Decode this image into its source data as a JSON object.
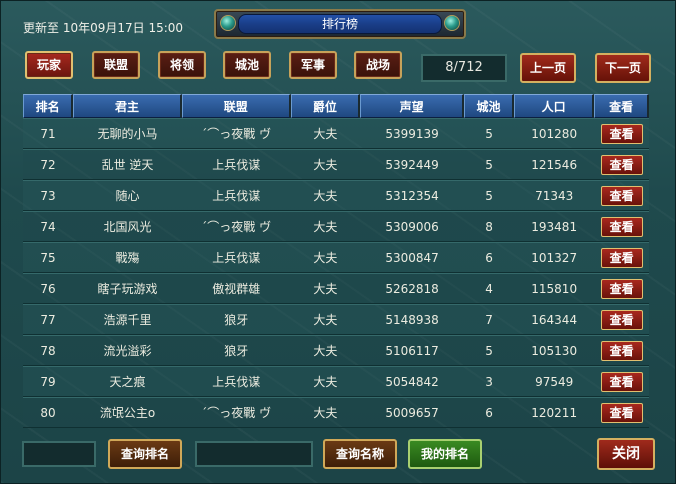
{
  "header": {
    "update_text": "更新至 10年09月17日 15:00",
    "title": "排行榜"
  },
  "tabs": [
    {
      "label": "玩家",
      "active": true
    },
    {
      "label": "联盟"
    },
    {
      "label": "将领"
    },
    {
      "label": "城池"
    },
    {
      "label": "军事"
    },
    {
      "label": "战场"
    }
  ],
  "pagination": {
    "page_text": "8/712",
    "prev_label": "上一页",
    "next_label": "下一页"
  },
  "table": {
    "columns": [
      "排名",
      "君主",
      "联盟",
      "爵位",
      "声望",
      "城池",
      "人口",
      "查看"
    ],
    "view_label": "查看",
    "rows": [
      {
        "rank": "71",
        "lord": "无聊的小马",
        "alliance": "ˊ⌒っ夜戰 ヴ",
        "title": "大夫",
        "prestige": "5399139",
        "cities": "5",
        "population": "101280"
      },
      {
        "rank": "72",
        "lord": "乱世 逆天",
        "alliance": "上兵伐谋",
        "title": "大夫",
        "prestige": "5392449",
        "cities": "5",
        "population": "121546"
      },
      {
        "rank": "73",
        "lord": "随心",
        "alliance": "上兵伐谋",
        "title": "大夫",
        "prestige": "5312354",
        "cities": "5",
        "population": "71343"
      },
      {
        "rank": "74",
        "lord": "北国风光",
        "alliance": "ˊ⌒っ夜戰 ヴ",
        "title": "大夫",
        "prestige": "5309006",
        "cities": "8",
        "population": "193481"
      },
      {
        "rank": "75",
        "lord": "戰殤",
        "alliance": "上兵伐谋",
        "title": "大夫",
        "prestige": "5300847",
        "cities": "6",
        "population": "101327"
      },
      {
        "rank": "76",
        "lord": "瞎子玩游戏",
        "alliance": "傲视群雄",
        "title": "大夫",
        "prestige": "5262818",
        "cities": "4",
        "population": "115810"
      },
      {
        "rank": "77",
        "lord": "浩源千里",
        "alliance": "狼牙",
        "title": "大夫",
        "prestige": "5148938",
        "cities": "7",
        "population": "164344"
      },
      {
        "rank": "78",
        "lord": "流光溢彩",
        "alliance": "狼牙",
        "title": "大夫",
        "prestige": "5106117",
        "cities": "5",
        "population": "105130"
      },
      {
        "rank": "79",
        "lord": "天之痕",
        "alliance": "上兵伐谋",
        "title": "大夫",
        "prestige": "5054842",
        "cities": "3",
        "population": "97549"
      },
      {
        "rank": "80",
        "lord": "流氓公主ο",
        "alliance": "ˊ⌒っ夜戰 ヴ",
        "title": "大夫",
        "prestige": "5009657",
        "cities": "6",
        "population": "120211"
      }
    ]
  },
  "footer": {
    "query_rank_label": "查询排名",
    "query_name_label": "查询名称",
    "my_rank_label": "我的排名",
    "close_label": "关闭"
  }
}
